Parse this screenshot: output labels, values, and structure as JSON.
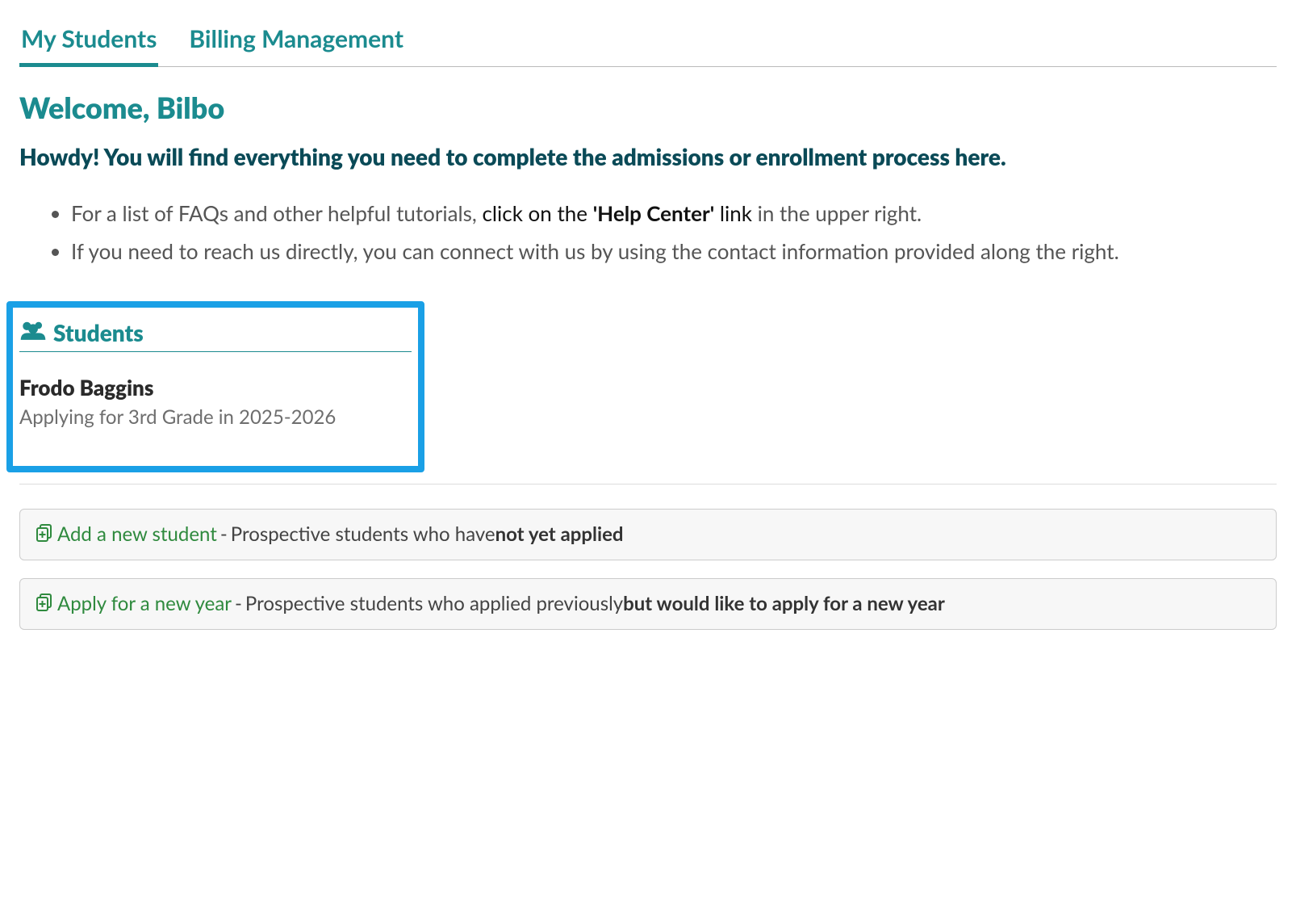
{
  "tabs": {
    "my_students": "My Students",
    "billing": "Billing Management"
  },
  "welcome_heading": "Welcome, Bilbo",
  "intro_text": "Howdy! You will find everything you need to complete the admissions or enrollment process here.",
  "bullets": {
    "faq_prefix": "For a list of FAQs and other helpful tutorials, ",
    "faq_mid": "click on the ",
    "faq_link_label": "'Help Center'",
    "faq_mid2": " link",
    "faq_suffix": " in the upper right.",
    "contact": "If you need to reach us directly, you can connect with us by using the contact information provided along the right."
  },
  "students": {
    "section_label": "Students",
    "items": [
      {
        "name": "Frodo Baggins",
        "status": "Applying for 3rd Grade in 2025-2026"
      }
    ]
  },
  "actions": {
    "add_student": {
      "link": "Add a new student",
      "dash": " - ",
      "desc_prefix": "Prospective students who have ",
      "desc_bold": "not yet applied"
    },
    "apply_new_year": {
      "link": "Apply for a new year",
      "dash": " - ",
      "desc_prefix": "Prospective students who applied previously ",
      "desc_bold": "but would like to apply for a new year"
    }
  }
}
